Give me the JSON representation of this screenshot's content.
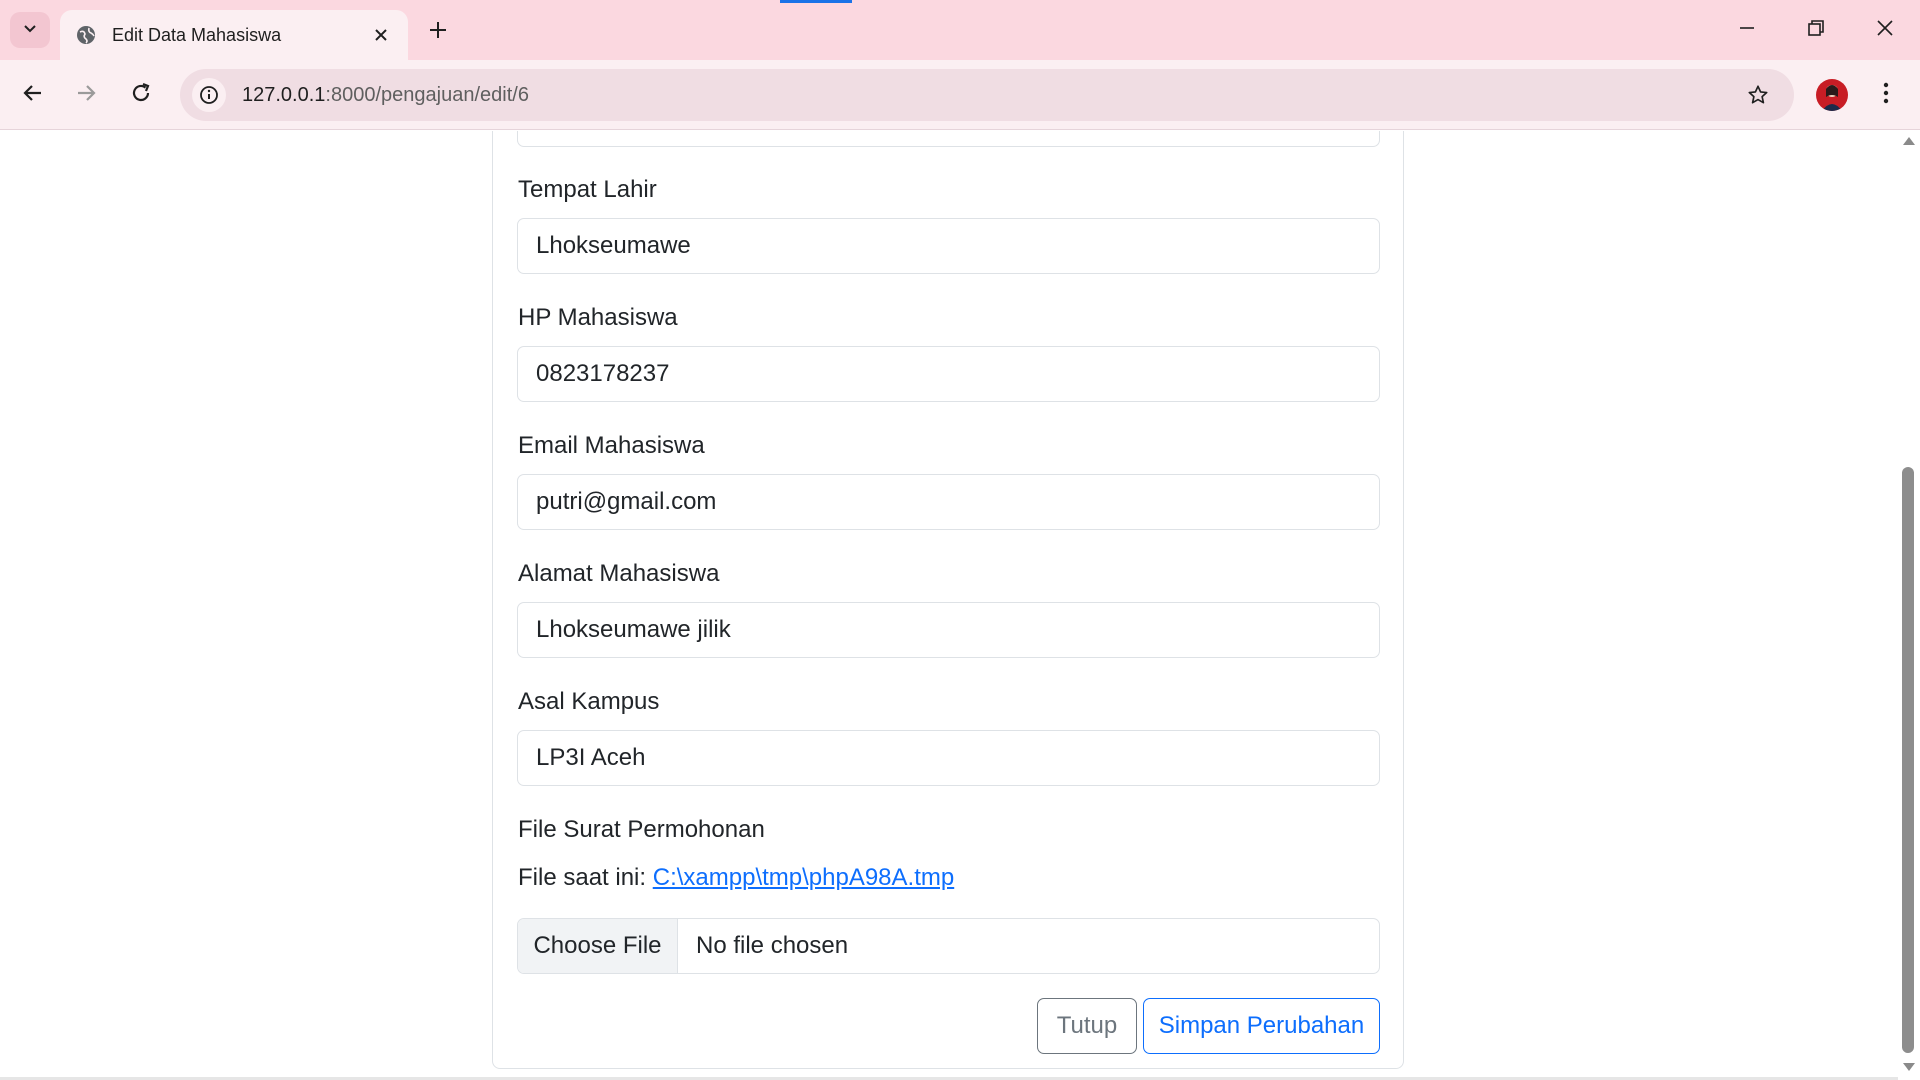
{
  "browser": {
    "tab_title": "Edit Data Mahasiswa",
    "url_host": "127.0.0.1",
    "url_path": ":8000/pengajuan/edit/6",
    "colors": {
      "tabbar": "#fbd8e0",
      "toolbar": "#fbeff2",
      "omnibox": "#f0dde3"
    },
    "icons": [
      "tab-search-icon",
      "globe-icon",
      "close-icon",
      "plus-icon",
      "minimize-icon",
      "restore-icon",
      "window-close-icon",
      "back-arrow-icon",
      "forward-arrow-icon",
      "reload-icon",
      "info-icon",
      "star-icon",
      "kebab-menu-icon"
    ]
  },
  "form": {
    "fields": [
      {
        "label": "Tempat Lahir",
        "value": "Lhokseumawe"
      },
      {
        "label": "HP Mahasiswa",
        "value": "0823178237"
      },
      {
        "label": "Email Mahasiswa",
        "value": "putri@gmail.com"
      },
      {
        "label": "Alamat Mahasiswa",
        "value": "Lhokseumawe jilik"
      },
      {
        "label": "Asal Kampus",
        "value": "LP3I Aceh"
      }
    ],
    "file": {
      "label": "File Surat Permohonan",
      "current_prefix": "File saat ini:",
      "current_link": "C:\\xampp\\tmp\\phpA98A.tmp",
      "choose_label": "Choose File",
      "status": "No file chosen"
    },
    "buttons": {
      "close": "Tutup",
      "save": "Simpan Perubahan"
    },
    "colors": {
      "primary": "#0d6efd",
      "secondary": "#6c757d",
      "border": "#dee2e6"
    }
  }
}
